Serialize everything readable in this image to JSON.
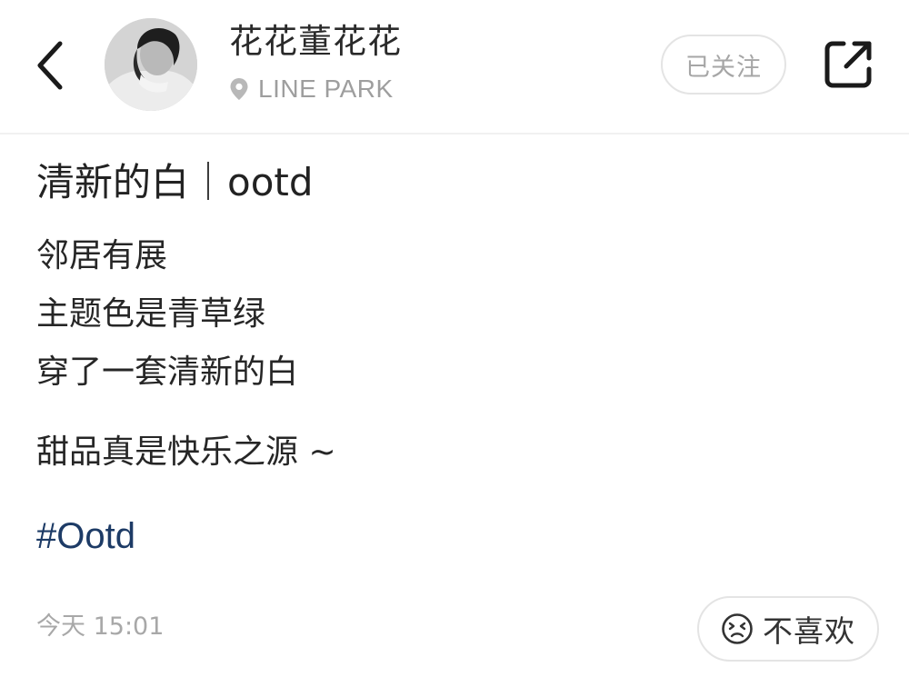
{
  "header": {
    "back_icon": "chevron-left-icon",
    "author": {
      "name": "花花董花花",
      "location_icon": "location-pin-icon",
      "location": "LINE PARK"
    },
    "follow_label": "已关注",
    "share_icon": "share-external-icon"
  },
  "post": {
    "title": "清新的白｜ootd",
    "lines": [
      "邻居有展",
      "主题色是青草绿",
      "穿了一套清新的白"
    ],
    "closing_line": "甜品真是快乐之源 ~",
    "hashtag": "#Ootd",
    "timestamp": "今天 15:01"
  },
  "actions": {
    "dislike_icon": "unhappy-face-icon",
    "dislike_label": "不喜欢"
  },
  "colors": {
    "hashtag": "#1d3b66",
    "secondary_text": "#a8a8a8",
    "button_border": "#e4e4e4"
  }
}
